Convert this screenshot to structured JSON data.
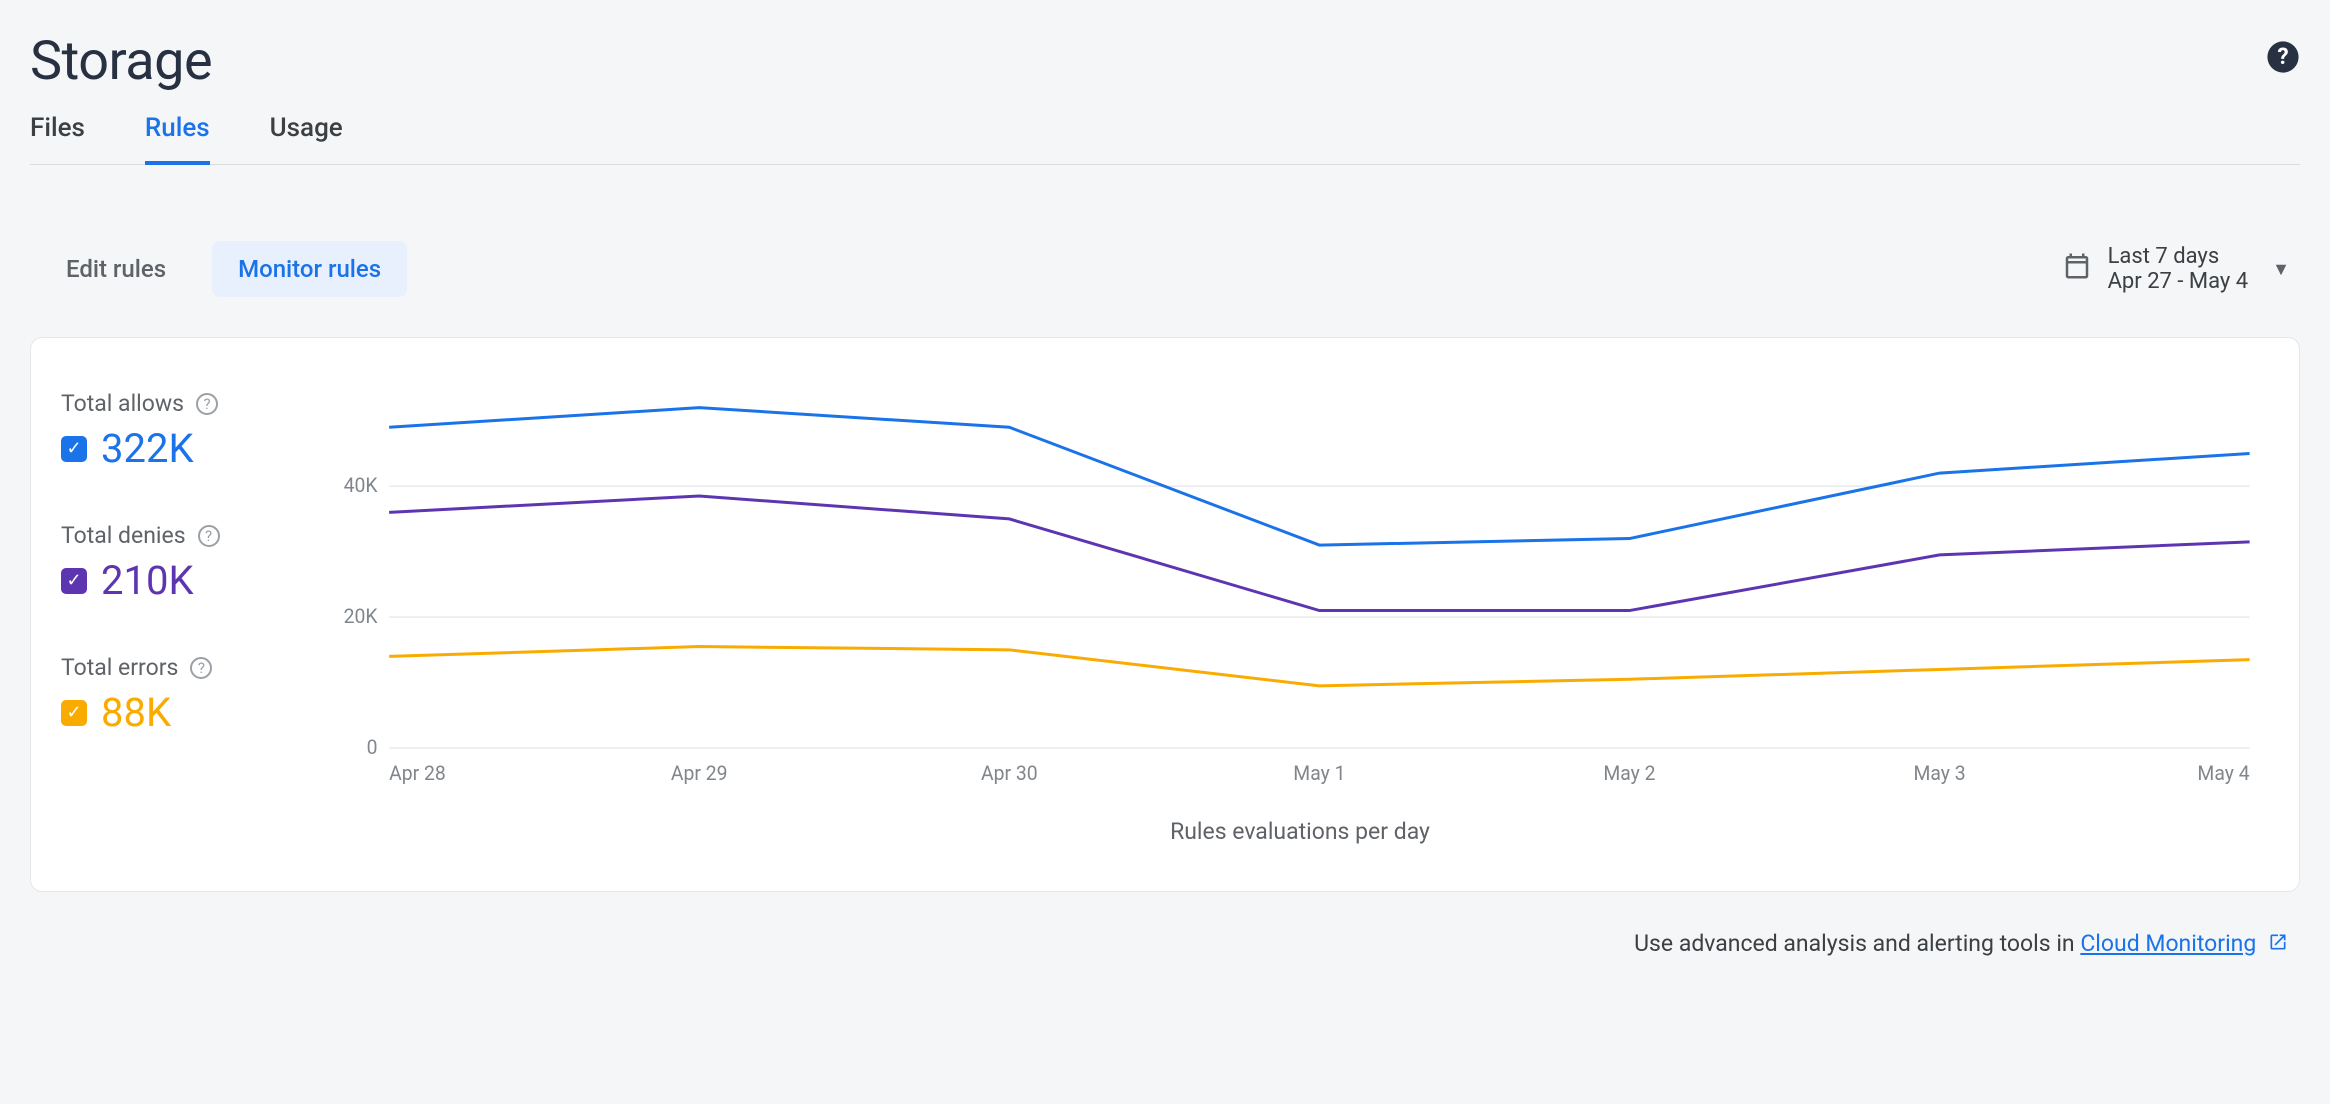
{
  "page": {
    "title": "Storage"
  },
  "tabs": [
    {
      "label": "Files",
      "active": false
    },
    {
      "label": "Rules",
      "active": true
    },
    {
      "label": "Usage",
      "active": false
    }
  ],
  "view_toggle": {
    "edit": "Edit rules",
    "monitor": "Monitor rules",
    "active": "monitor"
  },
  "date_picker": {
    "label": "Last 7 days",
    "range": "Apr 27 - May 4"
  },
  "totals": {
    "allows": {
      "label": "Total allows",
      "value": "322K"
    },
    "denies": {
      "label": "Total denies",
      "value": "210K"
    },
    "errors": {
      "label": "Total errors",
      "value": "88K"
    }
  },
  "chart_data": {
    "type": "line",
    "title": "",
    "xlabel": "Rules evaluations per day",
    "ylabel": "",
    "ylim": [
      0,
      55000
    ],
    "yticks": [
      0,
      20000,
      40000
    ],
    "ytick_labels": [
      "0",
      "20K",
      "40K"
    ],
    "categories": [
      "Apr 28",
      "Apr 29",
      "Apr 30",
      "May 1",
      "May 2",
      "May 3",
      "May 4"
    ],
    "series": [
      {
        "name": "allows",
        "values": [
          49000,
          52000,
          49000,
          31000,
          32000,
          42000,
          45000
        ]
      },
      {
        "name": "denies",
        "values": [
          36000,
          38500,
          35000,
          21000,
          21000,
          29500,
          31500
        ]
      },
      {
        "name": "errors",
        "values": [
          14000,
          15500,
          15000,
          9500,
          10500,
          12000,
          13500
        ]
      }
    ]
  },
  "footer": {
    "text": "Use advanced analysis and alerting tools in ",
    "link": "Cloud Monitoring"
  },
  "icons": {
    "help": "?",
    "check": "✓",
    "calendar": "date_range",
    "external": "↗"
  }
}
